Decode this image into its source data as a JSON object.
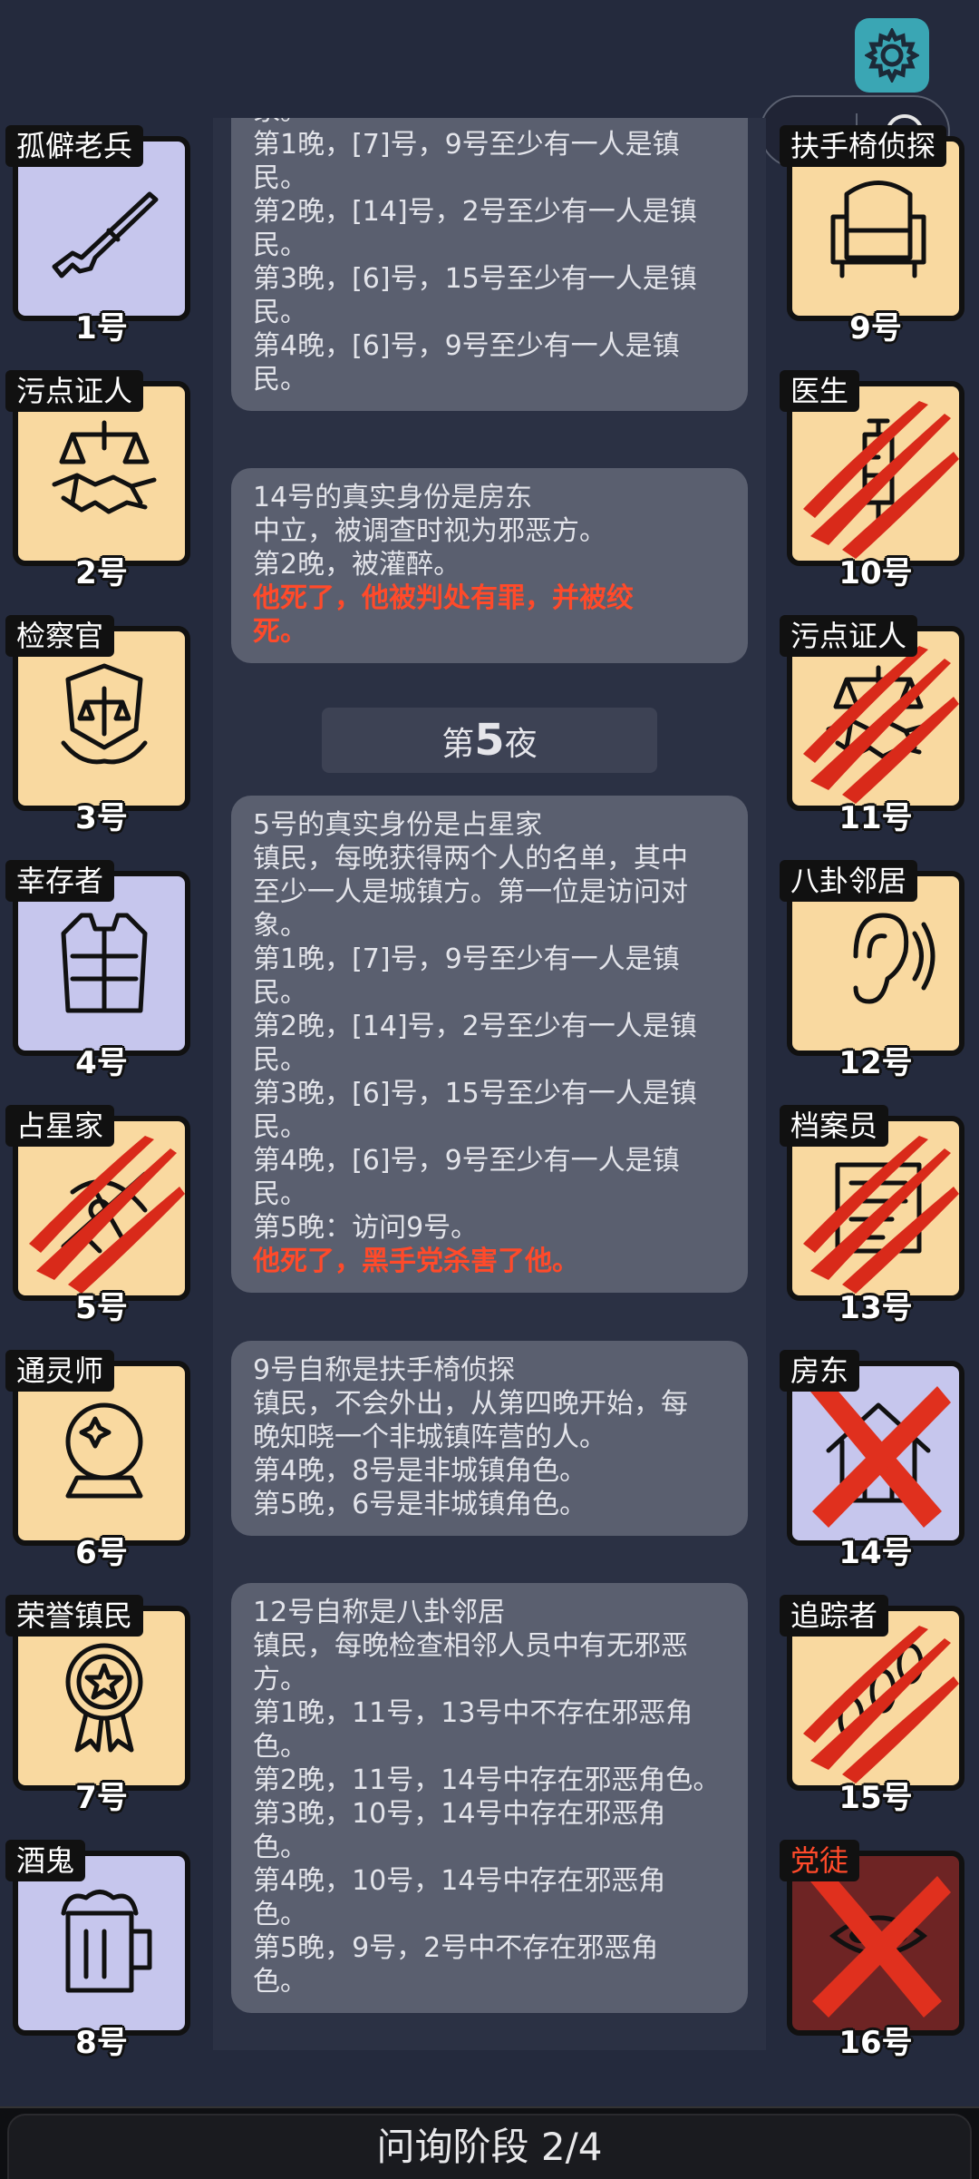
{
  "settings_icon": "gear-icon",
  "capsule": {
    "more_icon": "more-dots-icon",
    "close_icon": "target-icon"
  },
  "left_players": [
    {
      "role": "孤僻老兵",
      "num": "1号",
      "icon": "rifle-icon",
      "bg": "lav",
      "killed": false
    },
    {
      "role": "污点证人",
      "num": "2号",
      "icon": "handshake-icon",
      "bg": "gold",
      "killed": false
    },
    {
      "role": "检察官",
      "num": "3号",
      "icon": "shield-scales-icon",
      "bg": "gold",
      "killed": false
    },
    {
      "role": "幸存者",
      "num": "4号",
      "icon": "vest-icon",
      "bg": "lav",
      "killed": false
    },
    {
      "role": "占星家",
      "num": "5号",
      "icon": "sextant-icon",
      "bg": "gold",
      "killed": true
    },
    {
      "role": "通灵师",
      "num": "6号",
      "icon": "crystal-ball-icon",
      "bg": "gold",
      "killed": false
    },
    {
      "role": "荣誉镇民",
      "num": "7号",
      "icon": "medal-icon",
      "bg": "gold",
      "killed": false
    },
    {
      "role": "酒鬼",
      "num": "8号",
      "icon": "beer-icon",
      "bg": "lav",
      "killed": false
    }
  ],
  "right_players": [
    {
      "role": "扶手椅侦探",
      "num": "9号",
      "icon": "armchair-icon",
      "bg": "gold",
      "killed": false
    },
    {
      "role": "医生",
      "num": "10号",
      "icon": "syringe-icon",
      "bg": "gold",
      "killed": true
    },
    {
      "role": "污点证人",
      "num": "11号",
      "icon": "handshake-icon",
      "bg": "gold",
      "killed": true
    },
    {
      "role": "八卦邻居",
      "num": "12号",
      "icon": "ear-icon",
      "bg": "gold",
      "killed": false
    },
    {
      "role": "档案员",
      "num": "13号",
      "icon": "archive-icon",
      "bg": "gold",
      "killed": true
    },
    {
      "role": "房东",
      "num": "14号",
      "icon": "house-icon",
      "bg": "lav",
      "crossed": true
    },
    {
      "role": "追踪者",
      "num": "15号",
      "icon": "footprints-icon",
      "bg": "gold",
      "killed": true
    },
    {
      "role": "党徒",
      "num": "16号",
      "icon": "mask-icon",
      "bg": "dark",
      "crossed": true
    }
  ],
  "messages": [
    {
      "lines": [
        {
          "t": "家。"
        },
        {
          "t": "第1晚，[7]号，9号至少有一人是镇"
        },
        {
          "t": "民。"
        },
        {
          "t": "第2晚，[14]号，2号至少有一人是镇"
        },
        {
          "t": "民。"
        },
        {
          "t": "第3晚，[6]号，15号至少有一人是镇"
        },
        {
          "t": "民。"
        },
        {
          "t": "第4晚，[6]号，9号至少有一人是镇"
        },
        {
          "t": "民。"
        }
      ]
    },
    {
      "lines": [
        {
          "t": "14号的真实身份是房东"
        },
        {
          "t": "中立，被调查时视为邪恶方。"
        },
        {
          "t": "第2晚，被灌醉。"
        },
        {
          "t": "他死了，他被判处有罪，并被绞",
          "red": true
        },
        {
          "t": "死。",
          "red": true
        }
      ]
    },
    {
      "lines": [
        {
          "t": "5号的真实身份是占星家"
        },
        {
          "t": "镇民，每晚获得两个人的名单，其中"
        },
        {
          "t": "至少一人是城镇方。第一位是访问对"
        },
        {
          "t": "象。"
        },
        {
          "t": "第1晚，[7]号，9号至少有一人是镇"
        },
        {
          "t": "民。"
        },
        {
          "t": "第2晚，[14]号，2号至少有一人是镇"
        },
        {
          "t": "民。"
        },
        {
          "t": "第3晚，[6]号，15号至少有一人是镇"
        },
        {
          "t": "民。"
        },
        {
          "t": "第4晚，[6]号，9号至少有一人是镇"
        },
        {
          "t": "民。"
        },
        {
          "t": "第5晚：访问9号。"
        },
        {
          "t": "他死了，黑手党杀害了他。",
          "red": true
        }
      ]
    },
    {
      "lines": [
        {
          "t": "9号自称是扶手椅侦探"
        },
        {
          "t": "镇民，不会外出，从第四晚开始，每"
        },
        {
          "t": "晚知晓一个非城镇阵营的人。"
        },
        {
          "t": "第4晚，8号是非城镇角色。"
        },
        {
          "t": "第5晚，6号是非城镇角色。"
        }
      ]
    },
    {
      "lines": [
        {
          "t": "12号自称是八卦邻居"
        },
        {
          "t": "镇民，每晚检查相邻人员中有无邪恶"
        },
        {
          "t": "方。"
        },
        {
          "t": "第1晚，11号，13号中不存在邪恶角"
        },
        {
          "t": "色。"
        },
        {
          "t": "第2晚，11号，14号中存在邪恶角色。"
        },
        {
          "t": "第3晚，10号，14号中存在邪恶角"
        },
        {
          "t": "色。"
        },
        {
          "t": "第4晚，10号，14号中存在邪恶角"
        },
        {
          "t": "色。"
        },
        {
          "t": "第5晚，9号，2号中不存在邪恶角"
        },
        {
          "t": "色。"
        }
      ]
    }
  ],
  "night_divider": {
    "prefix": "第",
    "number": "5",
    "suffix": "夜"
  },
  "phase": "问询阶段 2/4"
}
